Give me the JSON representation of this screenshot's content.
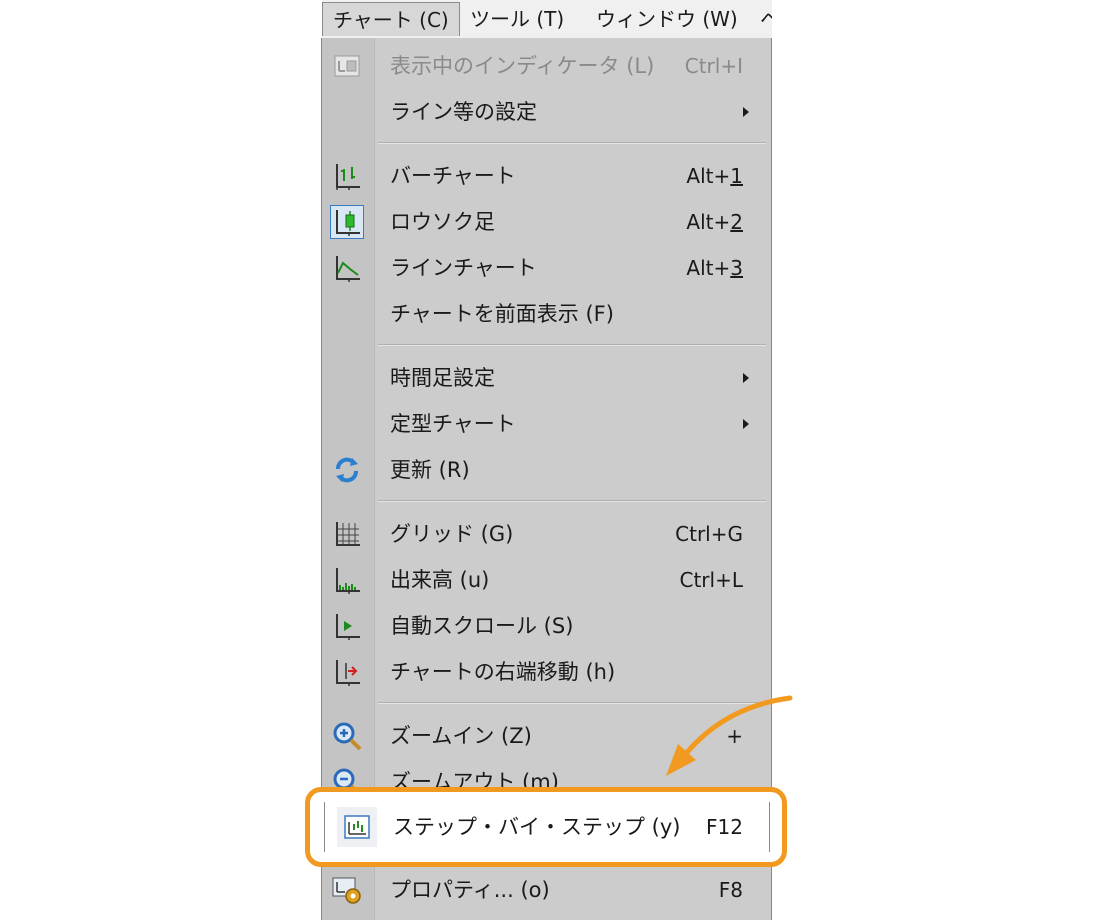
{
  "menubar": {
    "items": [
      {
        "label": "チャート (C)"
      },
      {
        "label": "ツール (T)"
      },
      {
        "label": "ウィンドウ (W)"
      },
      {
        "label": "ヘ"
      }
    ]
  },
  "menu": {
    "items": [
      {
        "label": "表示中のインディケータ (L)",
        "shortcut": "Ctrl+I",
        "icon": "indicator-icon"
      },
      {
        "label": "ライン等の設定",
        "icon": "",
        "submenu": true
      },
      {
        "label": "バーチャート",
        "shortcut_prefix": "Alt+",
        "shortcut_key": "1",
        "icon": "bar-chart-icon"
      },
      {
        "label": "ロウソク足",
        "shortcut_prefix": "Alt+",
        "shortcut_key": "2",
        "icon": "candlestick-icon"
      },
      {
        "label": "ラインチャート",
        "shortcut_prefix": "Alt+",
        "shortcut_key": "3",
        "icon": "line-chart-icon"
      },
      {
        "label": "チャートを前面表示 (F)"
      },
      {
        "label": "時間足設定",
        "submenu": true
      },
      {
        "label": "定型チャート",
        "submenu": true
      },
      {
        "label": "更新 (R)",
        "icon": "refresh-icon"
      },
      {
        "label": "グリッド (G)",
        "shortcut": "Ctrl+G",
        "icon": "grid-icon"
      },
      {
        "label": "出来高 (u)",
        "shortcut": "Ctrl+L",
        "icon": "volume-icon"
      },
      {
        "label": "自動スクロール (S)",
        "icon": "auto-scroll-icon"
      },
      {
        "label": "チャートの右端移動 (h)",
        "icon": "chart-shift-icon"
      },
      {
        "label": "ズームイン (Z)",
        "shortcut": "+",
        "icon": "zoom-in-icon"
      },
      {
        "label": "ズームアウト (m)",
        "icon": "zoom-out-icon"
      },
      {
        "label": "ステップ・バイ・ステップ (y)",
        "shortcut": "F12",
        "icon": "step-by-step-icon"
      },
      {
        "label": "プロパティ... (o)",
        "shortcut": "F8",
        "icon": "properties-icon"
      }
    ]
  },
  "colors": {
    "highlight": "#f29a1f",
    "menu_bg": "#cccccc",
    "accent_blue": "#3b7bbf"
  }
}
